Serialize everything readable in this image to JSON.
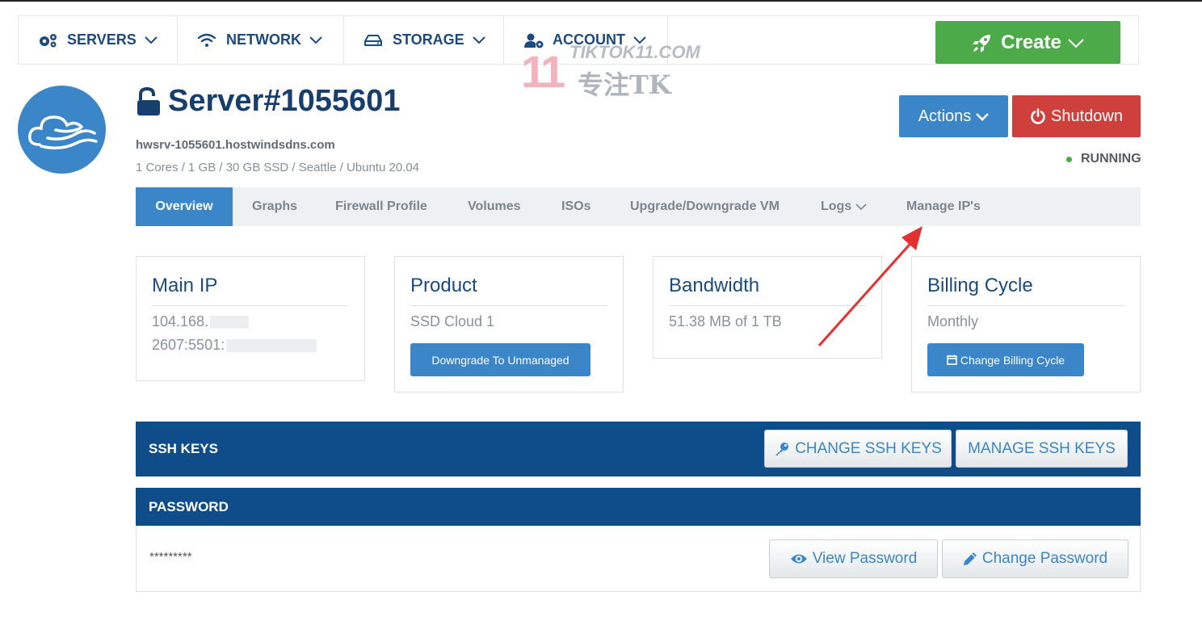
{
  "nav": {
    "items": [
      {
        "label": "SERVERS",
        "icon": "gears-icon"
      },
      {
        "label": "NETWORK",
        "icon": "wifi-icon"
      },
      {
        "label": "STORAGE",
        "icon": "hdd-icon"
      },
      {
        "label": "ACCOUNT",
        "icon": "user-gear-icon"
      }
    ],
    "create_label": "Create"
  },
  "watermark": {
    "num": "11",
    "en": "TIKTOK11.COM",
    "cn": "专注TK"
  },
  "server": {
    "title": "Server#1055601",
    "hostname": "hwsrv-1055601.hostwindsdns.com",
    "specs": "1 Cores / 1 GB / 30 GB SSD / Seattle / Ubuntu 20.04",
    "actions_label": "Actions",
    "shutdown_label": "Shutdown",
    "status": "RUNNING"
  },
  "tabs": [
    "Overview",
    "Graphs",
    "Firewall Profile",
    "Volumes",
    "ISOs",
    "Upgrade/Downgrade VM",
    "Logs",
    "Manage IP's"
  ],
  "cards": {
    "main_ip": {
      "title": "Main IP",
      "ipv4": "104.168.",
      "ipv6": "2607:5501:"
    },
    "product": {
      "title": "Product",
      "value": "SSD Cloud 1",
      "button": "Downgrade To Unmanaged"
    },
    "bandwidth": {
      "title": "Bandwidth",
      "value": "51.38 MB of 1 TB"
    },
    "billing": {
      "title": "Billing Cycle",
      "value": "Monthly",
      "button": "Change Billing Cycle"
    }
  },
  "ssh": {
    "title": "SSH KEYS",
    "change_label": "CHANGE SSH KEYS",
    "manage_label": "MANAGE SSH KEYS"
  },
  "password": {
    "title": "PASSWORD",
    "masked": "*********",
    "view_label": "View Password",
    "change_label": "Change Password"
  },
  "colors": {
    "brand_blue": "#3a86c8",
    "dark_blue": "#0f4c8a",
    "green": "#4caa48",
    "red": "#cf403d"
  }
}
